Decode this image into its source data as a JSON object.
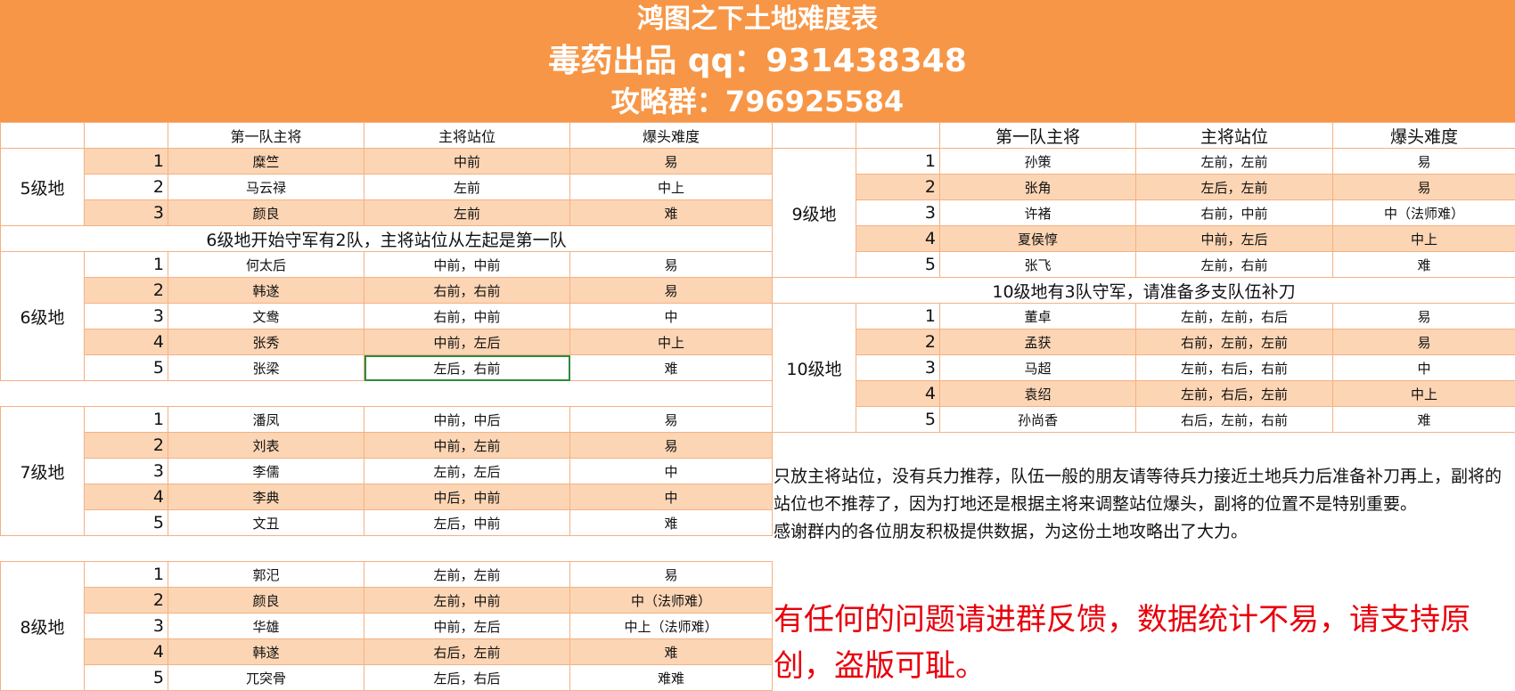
{
  "header": {
    "title": "鸿图之下土地难度表",
    "author": "毒药出品 qq：931438348",
    "group": "攻略群：796925584"
  },
  "columns": [
    "第一队主将",
    "主将站位",
    "爆头难度"
  ],
  "left": {
    "level5": {
      "label": "5级地",
      "rows": [
        {
          "no": "1",
          "general": "糜竺",
          "position": "中前",
          "difficulty": "易"
        },
        {
          "no": "2",
          "general": "马云禄",
          "position": "左前",
          "difficulty": "中上"
        },
        {
          "no": "3",
          "general": "颜良",
          "position": "左前",
          "difficulty": "难"
        }
      ]
    },
    "note6": "6级地开始守军有2队，主将站位从左起是第一队",
    "level6": {
      "label": "6级地",
      "rows": [
        {
          "no": "1",
          "general": "何太后",
          "position": "中前，中前",
          "difficulty": "易"
        },
        {
          "no": "2",
          "general": "韩遂",
          "position": "右前，右前",
          "difficulty": "易"
        },
        {
          "no": "3",
          "general": "文鸯",
          "position": "右前，中前",
          "difficulty": "中"
        },
        {
          "no": "4",
          "general": "张秀",
          "position": "中前，左后",
          "difficulty": "中上"
        },
        {
          "no": "5",
          "general": "张梁",
          "position": "左后，右前",
          "difficulty": "难"
        }
      ]
    },
    "level7": {
      "label": "7级地",
      "rows": [
        {
          "no": "1",
          "general": "潘凤",
          "position": "中前，中后",
          "difficulty": "易"
        },
        {
          "no": "2",
          "general": "刘表",
          "position": "中前，左前",
          "difficulty": "易"
        },
        {
          "no": "3",
          "general": "李儒",
          "position": "左前，左后",
          "difficulty": "中"
        },
        {
          "no": "4",
          "general": "李典",
          "position": "中后，中前",
          "difficulty": "中"
        },
        {
          "no": "5",
          "general": "文丑",
          "position": "左后，中前",
          "difficulty": "难"
        }
      ]
    },
    "level8": {
      "label": "8级地",
      "rows": [
        {
          "no": "1",
          "general": "郭汜",
          "position": "左前，左前",
          "difficulty": "易"
        },
        {
          "no": "2",
          "general": "颜良",
          "position": "左前，中前",
          "difficulty": "中（法师难）"
        },
        {
          "no": "3",
          "general": "华雄",
          "position": "中前，左后",
          "difficulty": "中上（法师难）"
        },
        {
          "no": "4",
          "general": "韩遂",
          "position": "右后，左前",
          "difficulty": "难"
        },
        {
          "no": "5",
          "general": "兀突骨",
          "position": "左后，右后",
          "difficulty": "难难"
        }
      ]
    }
  },
  "right": {
    "level9": {
      "label": "9级地",
      "rows": [
        {
          "no": "1",
          "general": "孙策",
          "position": "左前，左前",
          "difficulty": "易"
        },
        {
          "no": "2",
          "general": "张角",
          "position": "左后，左前",
          "difficulty": "易"
        },
        {
          "no": "3",
          "general": "许褚",
          "position": "右前，中前",
          "difficulty": "中（法师难）"
        },
        {
          "no": "4",
          "general": "夏侯惇",
          "position": "中前，左后",
          "difficulty": "中上"
        },
        {
          "no": "5",
          "general": "张飞",
          "position": "左前，右前",
          "difficulty": "难"
        }
      ]
    },
    "note10": "10级地有3队守军，请准备多支队伍补刀",
    "level10": {
      "label": "10级地",
      "rows": [
        {
          "no": "1",
          "general": "董卓",
          "position": "左前，左前，右后",
          "difficulty": "易"
        },
        {
          "no": "2",
          "general": "孟获",
          "position": "右前，左前，左前",
          "difficulty": "易"
        },
        {
          "no": "3",
          "general": "马超",
          "position": "左前，右后，右前",
          "difficulty": "中"
        },
        {
          "no": "4",
          "general": "袁绍",
          "position": "左前，右后，左前",
          "difficulty": "中上"
        },
        {
          "no": "5",
          "general": "孙尚香",
          "position": "右后，左前，右前",
          "difficulty": "难"
        }
      ]
    }
  },
  "notes": {
    "p1": "只放主将站位，没有兵力推荐，队伍一般的朋友请等待兵力接近土地兵力后准备补刀再上，副将的站位也不推荐了，因为打地还是根据主将来调整站位爆头，副将的位置不是特别重要。",
    "p2": "感谢群内的各位朋友积极提供数据，为这份土地攻略出了大力。",
    "warning": "有任何的问题请进群反馈，数据统计不易，请支持原创，盗版可耻。"
  }
}
